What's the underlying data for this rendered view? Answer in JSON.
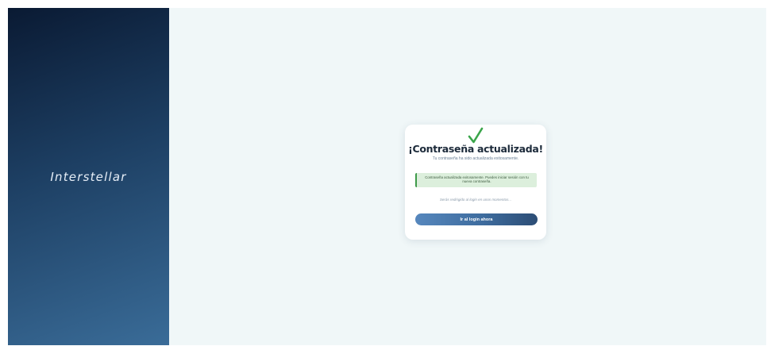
{
  "brand": {
    "logo_text": "Interstellar"
  },
  "card": {
    "icon": "check-icon",
    "title": "¡Contraseña actualizada!",
    "subtitle": "Tu contraseña ha sido actualizada exitosamente.",
    "alert_message": "Contraseña actualizada exitosamente. Puedes iniciar sesión con tu nueva contraseña.",
    "redirect_message": "Serás redirigido al login en unos momentos...",
    "button_label": "Ir al login ahora"
  },
  "colors": {
    "success": "#3e9a4a",
    "success_background": "#dcefdc",
    "primary": "#3e6c9e",
    "panel_dark": "#0a1a33",
    "content_background": "#f0f7f8"
  }
}
